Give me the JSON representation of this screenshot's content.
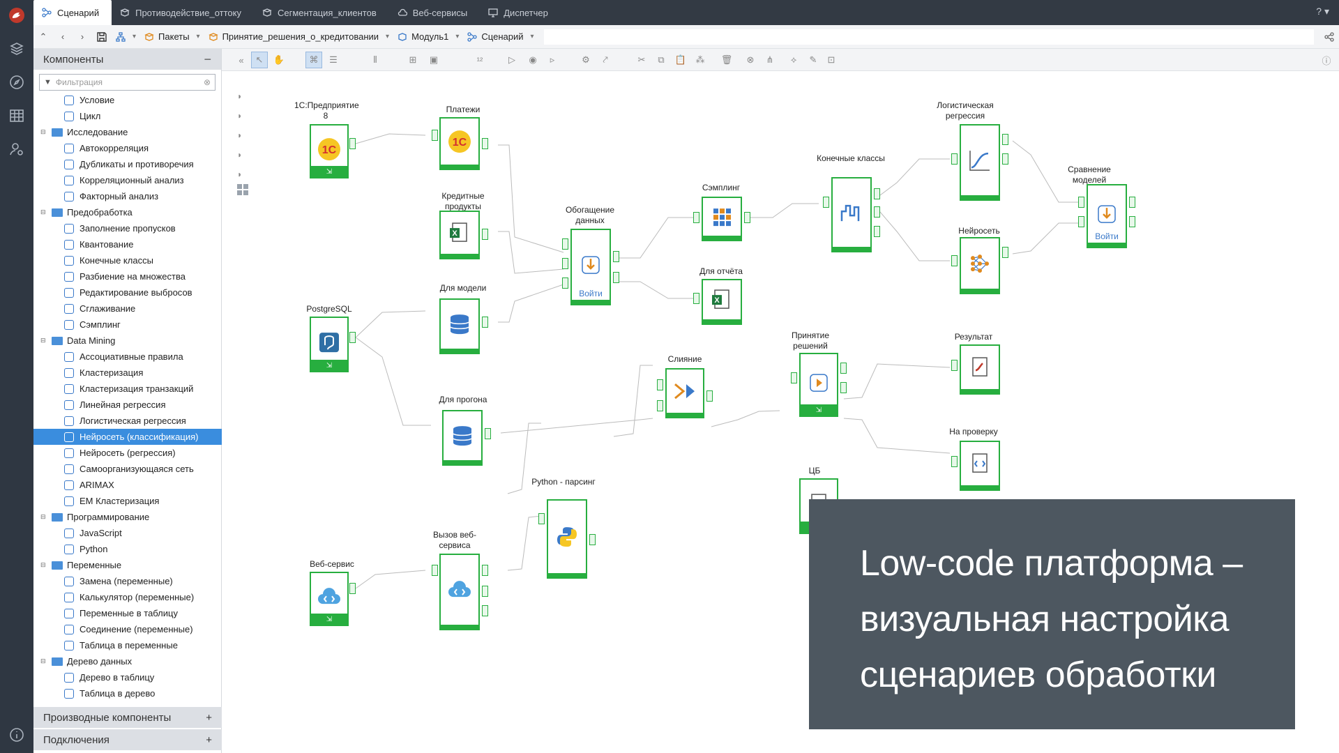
{
  "tabs": [
    {
      "label": "Сценарий",
      "active": true
    },
    {
      "label": "Противодействие_оттоку",
      "active": false
    },
    {
      "label": "Сегментация_клиентов",
      "active": false
    },
    {
      "label": "Веб-сервисы",
      "active": false
    },
    {
      "label": "Диспетчер",
      "active": false
    }
  ],
  "help_label": "?",
  "breadcrumbs": [
    "Пакеты",
    "Принятие_решения_о_кредитовании",
    "Модуль1",
    "Сценарий"
  ],
  "sidebar": {
    "title": "Компоненты",
    "filter_placeholder": "Фильтрация",
    "items": [
      {
        "label": "Условие",
        "type": "child"
      },
      {
        "label": "Цикл",
        "type": "child"
      },
      {
        "label": "Исследование",
        "type": "group"
      },
      {
        "label": "Автокорреляция",
        "type": "child"
      },
      {
        "label": "Дубликаты и противоречия",
        "type": "child"
      },
      {
        "label": "Корреляционный анализ",
        "type": "child"
      },
      {
        "label": "Факторный анализ",
        "type": "child"
      },
      {
        "label": "Предобработка",
        "type": "group"
      },
      {
        "label": "Заполнение пропусков",
        "type": "child"
      },
      {
        "label": "Квантование",
        "type": "child"
      },
      {
        "label": "Конечные классы",
        "type": "child"
      },
      {
        "label": "Разбиение на множества",
        "type": "child"
      },
      {
        "label": "Редактирование выбросов",
        "type": "child"
      },
      {
        "label": "Сглаживание",
        "type": "child"
      },
      {
        "label": "Сэмплинг",
        "type": "child"
      },
      {
        "label": "Data Mining",
        "type": "group"
      },
      {
        "label": "Ассоциативные правила",
        "type": "child"
      },
      {
        "label": "Кластеризация",
        "type": "child"
      },
      {
        "label": "Кластеризация транзакций",
        "type": "child"
      },
      {
        "label": "Линейная регрессия",
        "type": "child"
      },
      {
        "label": "Логистическая регрессия",
        "type": "child"
      },
      {
        "label": "Нейросеть (классификация)",
        "type": "child",
        "selected": true
      },
      {
        "label": "Нейросеть (регрессия)",
        "type": "child"
      },
      {
        "label": "Самоорганизующаяся сеть",
        "type": "child"
      },
      {
        "label": "ARIMAX",
        "type": "child"
      },
      {
        "label": "EM Кластеризация",
        "type": "child"
      },
      {
        "label": "Программирование",
        "type": "group"
      },
      {
        "label": "JavaScript",
        "type": "child"
      },
      {
        "label": "Python",
        "type": "child"
      },
      {
        "label": "Переменные",
        "type": "group"
      },
      {
        "label": "Замена (переменные)",
        "type": "child"
      },
      {
        "label": "Калькулятор (переменные)",
        "type": "child"
      },
      {
        "label": "Переменные в таблицу",
        "type": "child"
      },
      {
        "label": "Соединение (переменные)",
        "type": "child"
      },
      {
        "label": "Таблица в переменные",
        "type": "child"
      },
      {
        "label": "Дерево данных",
        "type": "group"
      },
      {
        "label": "Дерево в таблицу",
        "type": "child"
      },
      {
        "label": "Таблица в дерево",
        "type": "child"
      }
    ],
    "footer1": "Производные компоненты",
    "footer2": "Подключения"
  },
  "nodes": [
    {
      "id": "1c8",
      "label": "1С:Предприятие 8",
      "icon": "1c-icon"
    },
    {
      "id": "payments",
      "label": "Платежи",
      "icon": "1c-icon"
    },
    {
      "id": "credit",
      "label": "Кредитные продукты",
      "icon": "excel-icon"
    },
    {
      "id": "model",
      "label": "Для модели",
      "icon": "database-icon"
    },
    {
      "id": "postgres",
      "label": "PostgreSQL",
      "icon": "postgresql-icon"
    },
    {
      "id": "run",
      "label": "Для прогона",
      "icon": "database-icon"
    },
    {
      "id": "enrich",
      "label": "Обогащение данных",
      "icon": "enrich-icon",
      "button": "Войти"
    },
    {
      "id": "sampling",
      "label": "Сэмплинг",
      "icon": "grid-icon"
    },
    {
      "id": "report",
      "label": "Для отчёта",
      "icon": "excel-icon"
    },
    {
      "id": "classes",
      "label": "Конечные классы",
      "icon": "classes-icon"
    },
    {
      "id": "logreg",
      "label": "Логистическая регрессия",
      "icon": "curve-icon"
    },
    {
      "id": "neural",
      "label": "Нейросеть",
      "icon": "neural-icon"
    },
    {
      "id": "compare",
      "label": "Сравнение моделей",
      "icon": "compare-icon",
      "button": "Войти"
    },
    {
      "id": "merge",
      "label": "Слияние",
      "icon": "merge-icon"
    },
    {
      "id": "decision",
      "label": "Принятие решений",
      "icon": "decision-icon"
    },
    {
      "id": "result",
      "label": "Результат",
      "icon": "result-icon"
    },
    {
      "id": "review",
      "label": "На проверку",
      "icon": "code-file-icon"
    },
    {
      "id": "cb",
      "label": "ЦБ",
      "icon": "code-file-icon"
    },
    {
      "id": "python",
      "label": "Python - парсинг",
      "icon": "python-icon"
    },
    {
      "id": "callws",
      "label": "Вызов веб-сервиса",
      "icon": "cloud-code-icon"
    },
    {
      "id": "ws",
      "label": "Веб-сервис",
      "icon": "cloud-code-icon"
    }
  ],
  "overlay": {
    "line1": "Low-code платформа –",
    "line2": "визуальная настройка",
    "line3": "сценариев обработки"
  },
  "colors": {
    "accent": "#27ae3f",
    "rail": "#2f3742",
    "selection": "#3a8dde",
    "overlay": "#4d5760"
  }
}
